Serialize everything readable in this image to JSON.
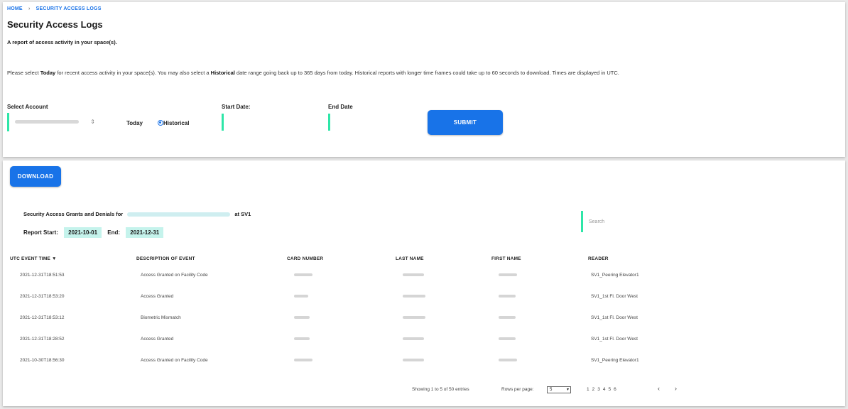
{
  "breadcrumb": {
    "home": "HOME",
    "current": "SECURITY ACCESS LOGS"
  },
  "page_title": "Security Access Logs",
  "subtitle": "A report of access activity in your space(s).",
  "instructions": {
    "part1": "Please select ",
    "today": "Today",
    "part2": " for recent access activity in your space(s). You may also select a ",
    "historical": "Historical",
    "part3": " date range going back up to 365 days from today. Historical reports with longer time frames could take up to 60 seconds to download. Times are displayed in UTC."
  },
  "form": {
    "account_label": "Select Account",
    "today_label": "Today",
    "historical_label": "Historical",
    "selected_mode": "historical",
    "start_label": "Start Date:",
    "start_value": "",
    "end_label": "End Date",
    "end_value": "",
    "submit_label": "SUBMIT"
  },
  "download_label": "DOWNLOAD",
  "report": {
    "title_prefix": "Security Access Grants and Denials for",
    "title_suffix": "at SV1",
    "start_label": "Report Start:",
    "start_date": "2021-10-01",
    "end_label": "End:",
    "end_date": "2021-12-31",
    "search_placeholder": "Search"
  },
  "table": {
    "columns": [
      "UTC EVENT TIME ▼",
      "DESCRIPTION OF EVENT",
      "CARD NUMBER",
      "LAST NAME",
      "FIRST NAME",
      "READER"
    ],
    "rows": [
      {
        "time": "2021-12-31T18:51:53",
        "description": "Access Granted on Facility Code",
        "reader": "SV1_Peering Elevator1"
      },
      {
        "time": "2021-12-31T18:53:20",
        "description": "Access Granted",
        "reader": "SV1_1st Fl. Door West"
      },
      {
        "time": "2021-12-31T18:53:12",
        "description": "Biometric Mismatch",
        "reader": "SV1_1st Fl. Door West"
      },
      {
        "time": "2021-12-31T18:28:52",
        "description": "Access Granted",
        "reader": "SV1_1st Fl. Door West"
      },
      {
        "time": "2021-10-30T18:56:30",
        "description": "Access Granted on Facility Code",
        "reader": "SV1_Peering Elevator1"
      }
    ]
  },
  "pagination": {
    "showing": "Showing 1 to 5 of 50 entries",
    "rows_per_page_label": "Rows per page:",
    "rows_per_page_value": "5",
    "pages": [
      "1",
      "2",
      "3",
      "4",
      "5",
      "6"
    ],
    "prev": "‹",
    "next": "›"
  },
  "colors": {
    "accent": "#1873e8",
    "field_marker": "#2ee6a8",
    "chip": "#c5f3ec"
  }
}
